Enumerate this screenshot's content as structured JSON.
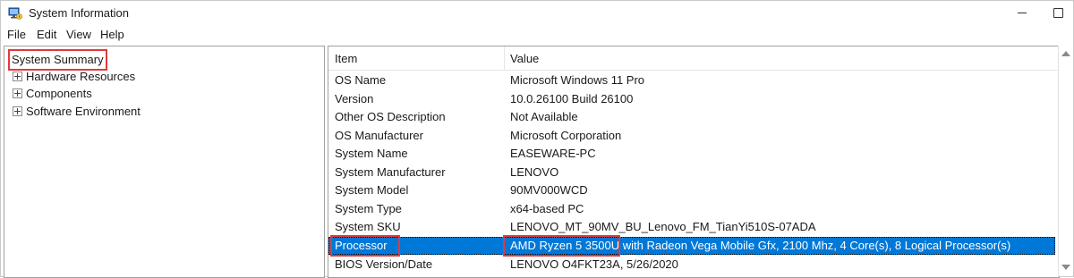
{
  "window": {
    "title": "System Information"
  },
  "menu": [
    "File",
    "Edit",
    "View",
    "Help"
  ],
  "tree": {
    "root": "System Summary",
    "children": [
      "Hardware Resources",
      "Components",
      "Software Environment"
    ]
  },
  "table": {
    "columns": [
      "Item",
      "Value"
    ],
    "rows": [
      {
        "item": "OS Name",
        "value": "Microsoft Windows 11 Pro"
      },
      {
        "item": "Version",
        "value": "10.0.26100 Build 26100"
      },
      {
        "item": "Other OS Description",
        "value": "Not Available"
      },
      {
        "item": "OS Manufacturer",
        "value": "Microsoft Corporation"
      },
      {
        "item": "System Name",
        "value": "EASEWARE-PC"
      },
      {
        "item": "System Manufacturer",
        "value": "LENOVO"
      },
      {
        "item": "System Model",
        "value": "90MV000WCD"
      },
      {
        "item": "System Type",
        "value": "x64-based PC"
      },
      {
        "item": "System SKU",
        "value": "LENOVO_MT_90MV_BU_Lenovo_FM_TianYi510S-07ADA"
      },
      {
        "item": "Processor",
        "value": "AMD Ryzen 5 3500U with Radeon Vega Mobile Gfx, 2100 Mhz, 4 Core(s), 8 Logical Processor(s)"
      },
      {
        "item": "BIOS Version/Date",
        "value": "LENOVO O4FKT23A, 5/26/2020"
      }
    ],
    "selected_row": "Processor"
  },
  "colors": {
    "selection": "#0078d7",
    "highlight_box": "#e03a3e"
  },
  "icons": {
    "app": "system-information-icon",
    "expand": "plus-expander-icon"
  }
}
